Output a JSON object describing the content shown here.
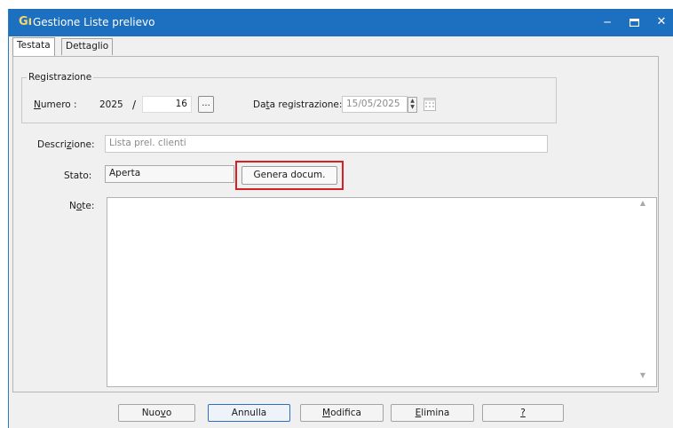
{
  "window": {
    "title": "Gestione Liste prelievo",
    "app_icon": "Gı"
  },
  "tabs": [
    {
      "label": "Testata",
      "active": true
    },
    {
      "label": "Dettaglio",
      "active": false
    }
  ],
  "registrazione": {
    "group_label": "Registrazione",
    "numero_label_u": "N",
    "numero_label_rest": "umero :",
    "year": "2025",
    "separator": "/",
    "number": "16",
    "lookup_label": "...",
    "data_label_a": "Da",
    "data_label_u": "t",
    "data_label_b": "a registrazione:",
    "data_value": "15/05/2025"
  },
  "descrizione": {
    "label_a": "Descri",
    "label_u": "z",
    "label_b": "ione:",
    "value": "Lista prel. clienti"
  },
  "stato": {
    "label": "Stato:",
    "value": "Aperta"
  },
  "genera_button": "Genera docum.",
  "note": {
    "label_a": "N",
    "label_u": "o",
    "label_b": "te:",
    "value": ""
  },
  "buttons": {
    "nuovo_a": "Nuo",
    "nuovo_u": "v",
    "nuovo_b": "o",
    "annulla": "Annulla",
    "modifica_u": "M",
    "modifica_b": "odifica",
    "elimina_u": "E",
    "elimina_b": "limina",
    "help_u": "?"
  },
  "colors": {
    "titlebar": "#1d6fbf",
    "highlight": "#d81f26"
  }
}
